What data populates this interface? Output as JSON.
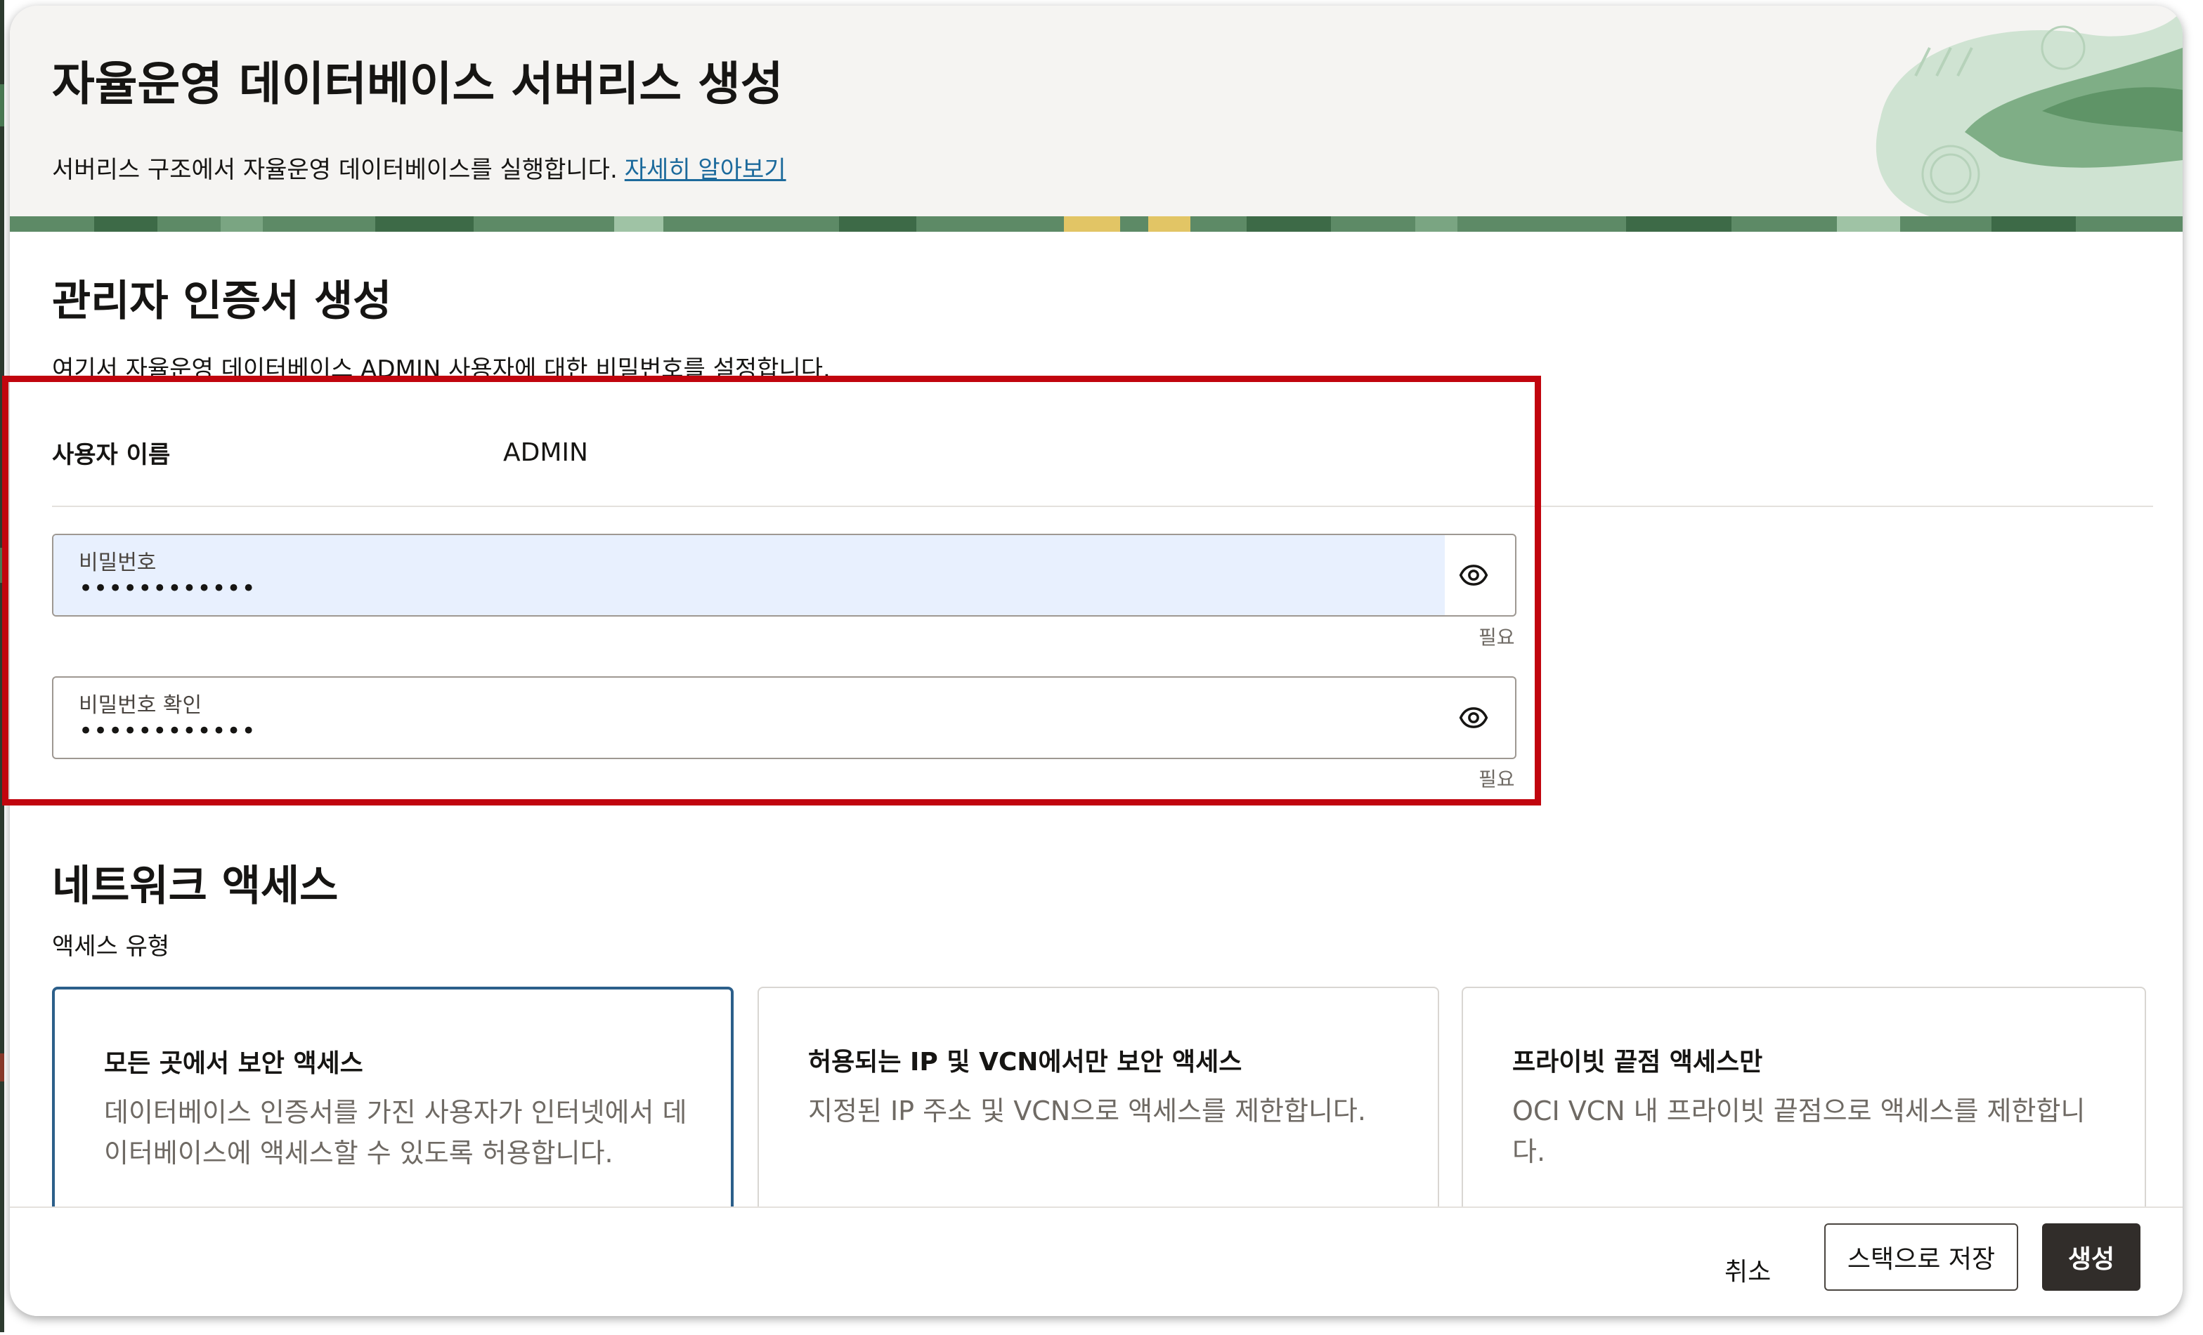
{
  "header": {
    "title": "자율운영 데이터베이스 서버리스 생성",
    "subtitle": "서버리스 구조에서 자율운영 데이터베이스를 실행합니다.",
    "learn_more": "자세히 알아보기"
  },
  "credentials": {
    "title": "관리자 인증서 생성",
    "description": "여기서 자율운영 데이터베이스 ADMIN 사용자에 대한 비밀번호를 설정합니다.",
    "username_label": "사용자 이름",
    "username_value": "ADMIN",
    "password": {
      "label": "비밀번호",
      "value": "••••••••••••",
      "required": "필요"
    },
    "confirm_password": {
      "label": "비밀번호 확인",
      "value": "••••••••••••",
      "required": "필요"
    }
  },
  "network": {
    "title": "네트워크 액세스",
    "access_type_label": "액세스 유형",
    "options": [
      {
        "title": "모든 곳에서 보안 액세스",
        "description": "데이터베이스 인증서를 가진 사용자가 인터넷에서 데이터베이스에 액세스할 수 있도록 허용합니다.",
        "selected": true
      },
      {
        "title": "허용되는 IP 및 VCN에서만 보안 액세스",
        "description": "지정된 IP 주소 및 VCN으로 액세스를 제한합니다.",
        "selected": false
      },
      {
        "title": "프라이빗 끝점 액세스만",
        "description": "OCI VCN 내 프라이빗 끝점으로 액세스를 제한합니다.",
        "selected": false
      }
    ]
  },
  "footer": {
    "cancel": "취소",
    "save_stack": "스택으로 저장",
    "create": "생성"
  },
  "colors": {
    "highlight": "#c1050e",
    "link": "#1c6a9c",
    "selected_card_border": "#2c5f8a",
    "primary_button": "#312d2a",
    "autofill_bg": "#e8f0fe"
  }
}
